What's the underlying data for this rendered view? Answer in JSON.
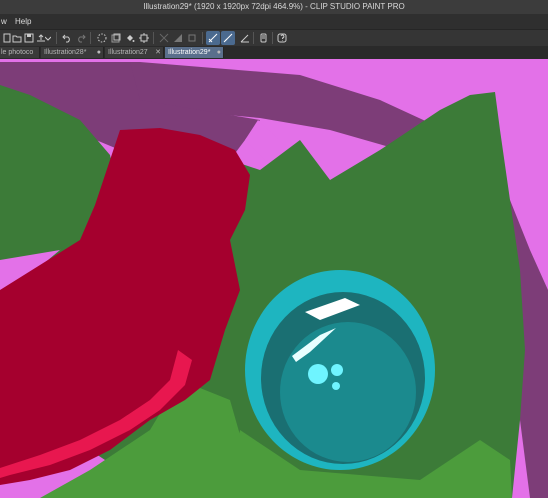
{
  "window": {
    "title": "Illustration29* (1920 x 1920px 72dpi 464.9%)  - CLIP STUDIO PAINT PRO"
  },
  "menubar": {
    "items": [
      {
        "label": "w"
      },
      {
        "label": "Help"
      }
    ]
  },
  "toolbar": {
    "icons": [
      "new-file-icon",
      "open-file-icon",
      "save-icon",
      "export-icon",
      "dropdown-icon",
      "undo-icon",
      "redo-icon",
      "clear-icon",
      "transform-icon",
      "fill-icon",
      "fit-icon",
      "lasso-icon",
      "erase-outside-icon",
      "rectangle-icon",
      "snap-ruler-icon",
      "snap-special-icon",
      "ruler-pen-icon",
      "device-icon",
      "info-icon"
    ],
    "active": [
      "snap-ruler-icon",
      "snap-special-icon"
    ]
  },
  "tabs": [
    {
      "label": "le photoco",
      "active": false
    },
    {
      "label": "Illustration28*",
      "active": false
    },
    {
      "label": "Illustration27",
      "active": false
    },
    {
      "label": "Illustration29*",
      "active": true
    }
  ],
  "colors": {
    "background_pink": "#e371e8",
    "purple_stroke": "#7d3d78",
    "green": "#3c7b38",
    "light_green": "#4c9c3c",
    "crimson": "#a5002e",
    "pink_red": "#e8174f",
    "teal_ring": "#1eb5c0",
    "teal_dark": "#1a6f72",
    "teal_mid": "#1b8a8e"
  }
}
